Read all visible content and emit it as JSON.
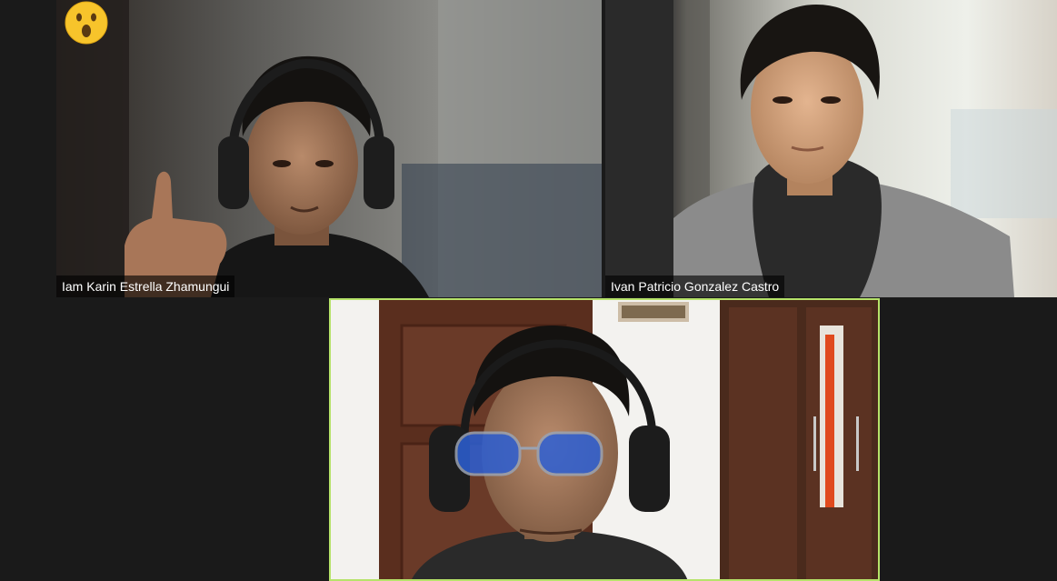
{
  "meeting": {
    "participants": [
      {
        "name": "Iam Karin Estrella Zhamungui",
        "reaction": "surprised-face-emoji"
      },
      {
        "name": "Ivan Patricio Gonzalez Castro",
        "reaction": ""
      },
      {
        "name": "",
        "reaction": "",
        "active_speaker": true
      }
    ],
    "colors": {
      "background": "#1a1a1a",
      "active_speaker_border": "#b6e36a",
      "name_tag_bg": "rgba(0,0,0,0.62)",
      "name_tag_text": "#ffffff"
    }
  }
}
